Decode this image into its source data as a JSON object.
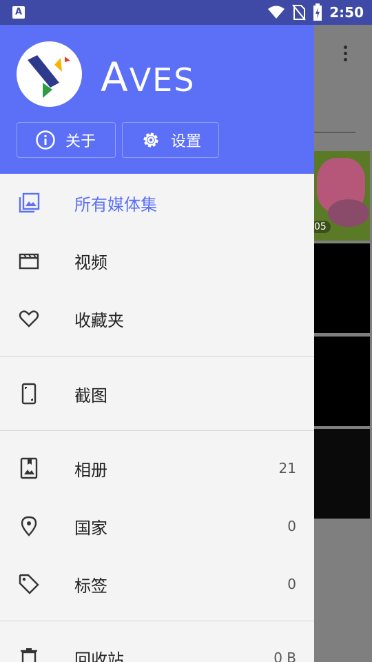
{
  "status_bar": {
    "time": "2:50",
    "left_icon_letter": "A",
    "icons": [
      "wifi-icon",
      "no-sim-icon",
      "battery-charging-icon"
    ]
  },
  "drawer": {
    "app_name_first": "A",
    "app_name_rest": "VES",
    "buttons": {
      "about": "关于",
      "settings": "设置"
    },
    "items": [
      {
        "label": "所有媒体集",
        "icon": "collection-icon",
        "active": true,
        "count": ""
      },
      {
        "label": "视频",
        "icon": "clapperboard-icon",
        "count": ""
      },
      {
        "label": "收藏夹",
        "icon": "heart-icon",
        "count": ""
      },
      {
        "label": "截图",
        "icon": "phone-screenshot-icon",
        "count": ""
      },
      {
        "label": "相册",
        "icon": "album-icon",
        "count": "21"
      },
      {
        "label": "国家",
        "icon": "location-pin-icon",
        "count": "0"
      },
      {
        "label": "标签",
        "icon": "tag-icon",
        "count": "0"
      },
      {
        "label": "回收站",
        "icon": "trash-icon",
        "count": "0 B"
      }
    ]
  },
  "background": {
    "thumb_badge": "05"
  },
  "colors": {
    "accent": "#5b6ff7",
    "status_bar": "#3f4aa6",
    "drawer_bg": "#f4f4f4"
  }
}
